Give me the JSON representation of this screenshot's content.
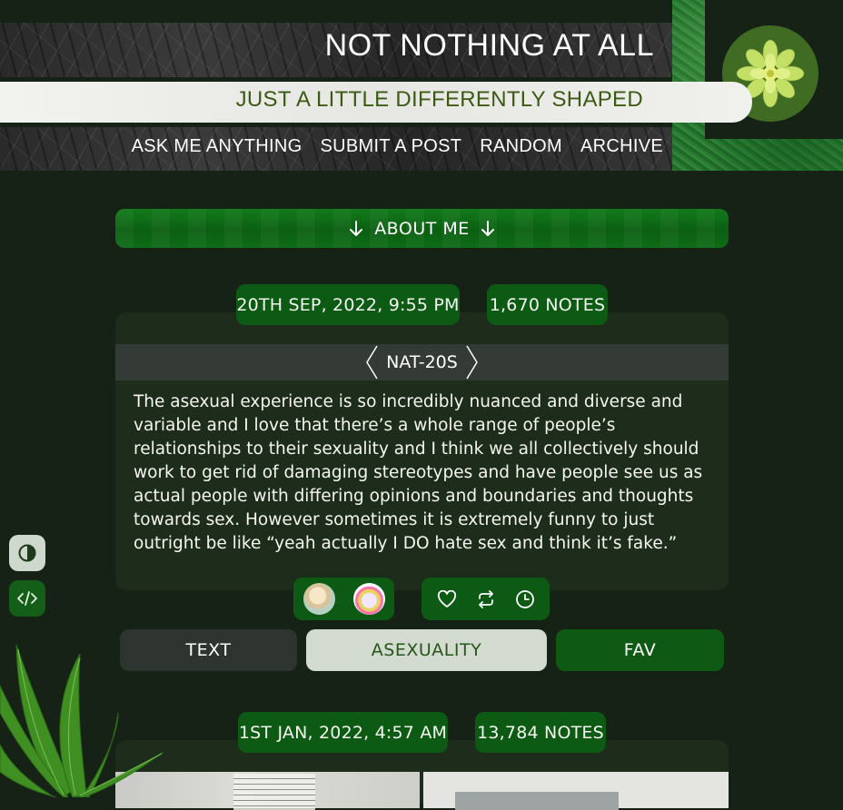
{
  "header": {
    "title": "NOT NOTHING AT ALL",
    "subtitle": "JUST A LITTLE DIFFERENTLY SHAPED",
    "nav": [
      "ASK ME ANYTHING",
      "SUBMIT A POST",
      "RANDOM",
      "ARCHIVE"
    ],
    "avatar_icon": "zinnia-flower-avatar"
  },
  "about": {
    "label": "ABOUT ME",
    "icon": "arrow-down-icon"
  },
  "sidebar_buttons": [
    {
      "icon": "contrast-icon"
    },
    {
      "icon": "code-icon"
    }
  ],
  "posts": [
    {
      "date": "20TH SEP, 2022, 9:55 PM",
      "notes": "1,670 NOTES",
      "reblogged_from": "NAT-20S",
      "body": "The asexual experience is so incredibly nuanced and diverse and variable and I love that there’s a whole range of people’s relationships to their sexuality and I think we all collectively should work to get rid of damaging stereotypes and have people see us as actual people with differing opinions and boundaries and thoughts towards sex. However sometimes it is extremely funny to just outright be like “yeah actually I DO hate sex and think it’s fake.”",
      "actions": [
        "heart-icon",
        "reblog-icon",
        "clock-icon"
      ],
      "tags": [
        "TEXT",
        "ASEXUALITY",
        "FAV"
      ]
    },
    {
      "date": "1ST JAN, 2022, 4:57 AM",
      "notes": "13,784 NOTES"
    }
  ],
  "colors": {
    "background": "#172216",
    "accent_green": "#0c5a13",
    "subtitle_text": "#3b5a14",
    "tag_light": "#d3dbd0"
  }
}
